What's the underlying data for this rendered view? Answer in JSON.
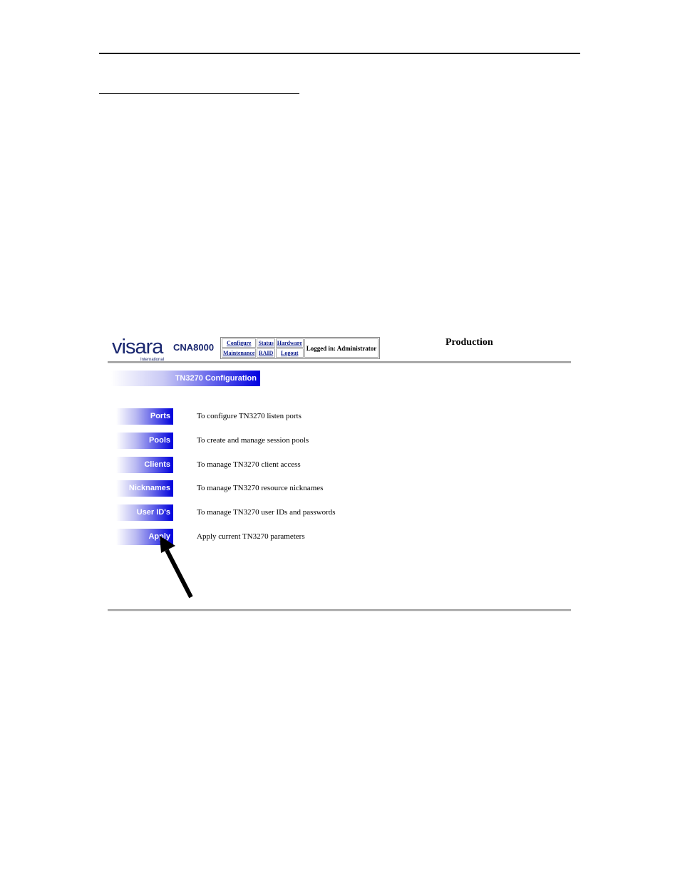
{
  "header": {
    "logo_text": "visara",
    "logo_sub": "International",
    "product": "CNA8000",
    "nav": {
      "configure": "Configure",
      "status": "Status",
      "hardware": "Hardware",
      "maintenance": "Maintenance",
      "raid": "RAID",
      "logout": "Logout"
    },
    "login_status": "Logged in: Administrator",
    "environment": "Production"
  },
  "section_title": "TN3270 Configuration",
  "menu": [
    {
      "label": "Ports",
      "description": "To configure TN3270 listen ports"
    },
    {
      "label": "Pools",
      "description": "To create and manage session pools"
    },
    {
      "label": "Clients",
      "description": "To manage TN3270 client access"
    },
    {
      "label": "Nicknames",
      "description": "To manage TN3270 resource nicknames"
    },
    {
      "label": "User ID's",
      "description": "To manage TN3270 user IDs and passwords"
    },
    {
      "label": "Apply",
      "description": "Apply current TN3270 parameters"
    }
  ],
  "colors": {
    "brand": "#1b2870",
    "button_blue": "#0000dc",
    "link": "#0a1a8a"
  },
  "icons": {
    "callout": "arrow-pointer-icon"
  }
}
